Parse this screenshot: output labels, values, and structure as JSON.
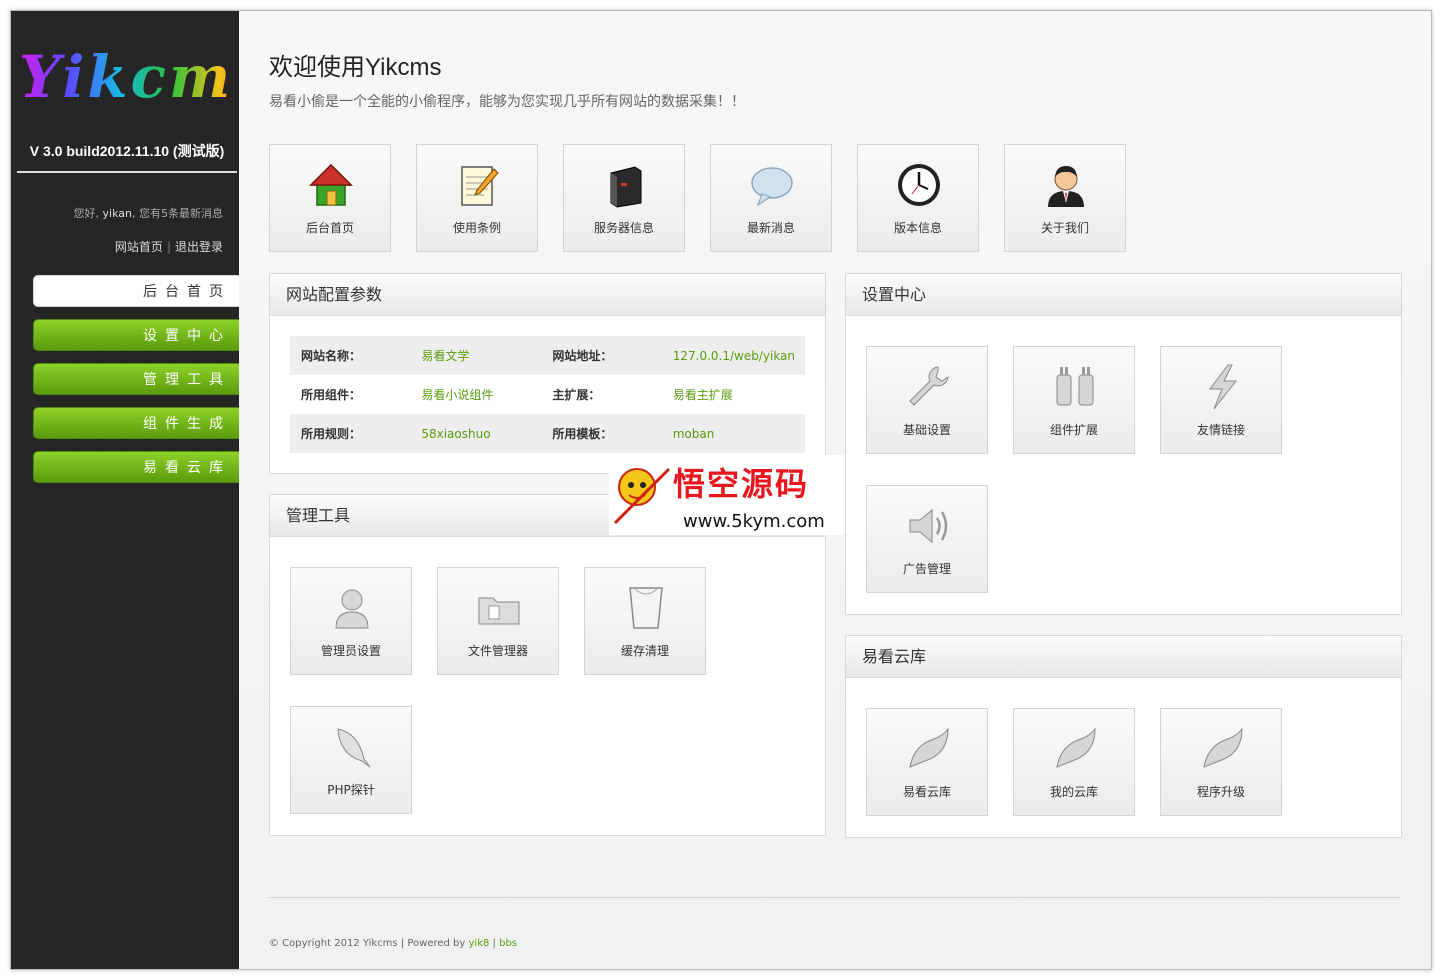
{
  "sidebar": {
    "logo_text": "Yikcms",
    "version": "V 3.0 build2012.11.10 (测试版)",
    "greeting_prefix": "您好,",
    "username": "yikan",
    "greeting_mid": ", 您有",
    "message_count": "5",
    "greeting_suffix": "条最新消息",
    "link_home": "网站首页",
    "link_separator": "|",
    "link_logout": "退出登录",
    "nav": [
      {
        "label": "后台首页",
        "active": true
      },
      {
        "label": "设置中心",
        "active": false
      },
      {
        "label": "管理工具",
        "active": false
      },
      {
        "label": "组件生成",
        "active": false
      },
      {
        "label": "易看云库",
        "active": false
      }
    ]
  },
  "header": {
    "title": "欢迎使用Yikcms",
    "subtitle": "易看小偷是一个全能的小偷程序，能够为您实现几乎所有网站的数据采集！！"
  },
  "quick_tiles": [
    {
      "label": "后台首页",
      "icon": "house-icon"
    },
    {
      "label": "使用条例",
      "icon": "notepad-icon"
    },
    {
      "label": "服务器信息",
      "icon": "server-icon"
    },
    {
      "label": "最新消息",
      "icon": "speech-bubble-icon"
    },
    {
      "label": "版本信息",
      "icon": "clock-icon"
    },
    {
      "label": "关于我们",
      "icon": "user-icon"
    }
  ],
  "config_panel": {
    "title": "网站配置参数",
    "rows": [
      [
        {
          "k": "网站名称：",
          "v": "易看文学"
        },
        {
          "k": "网站地址：",
          "v": "127.0.0.1/web/yikan"
        }
      ],
      [
        {
          "k": "所用组件：",
          "v": "易看小说组件"
        },
        {
          "k": "主扩展：",
          "v": "易看主扩展"
        }
      ],
      [
        {
          "k": "所用规则：",
          "v": "58xiaoshuo"
        },
        {
          "k": "所用模板：",
          "v": "moban"
        }
      ]
    ]
  },
  "tools_panel": {
    "title": "管理工具",
    "tiles": [
      {
        "label": "管理员设置",
        "icon": "admin-user-icon"
      },
      {
        "label": "文件管理器",
        "icon": "folder-icon"
      },
      {
        "label": "缓存清理",
        "icon": "cup-icon"
      },
      {
        "label": "PHP探针",
        "icon": "feather-icon"
      }
    ]
  },
  "settings_panel": {
    "title": "设置中心",
    "tiles": [
      {
        "label": "基础设置",
        "icon": "wrench-icon"
      },
      {
        "label": "组件扩展",
        "icon": "plug-icon"
      },
      {
        "label": "友情链接",
        "icon": "lightning-icon"
      },
      {
        "label": "广告管理",
        "icon": "speaker-icon"
      }
    ]
  },
  "cloud_panel": {
    "title": "易看云库",
    "tiles": [
      {
        "label": "易看云库",
        "icon": "leaf-icon"
      },
      {
        "label": "我的云库",
        "icon": "leaf-icon"
      },
      {
        "label": "程序升级",
        "icon": "leaf-icon"
      }
    ]
  },
  "watermark": {
    "title": "悟空源码",
    "url": "www.5kym.com"
  },
  "footer": {
    "text": "© Copyright 2012 Yikcms | Powered by",
    "link1": "yik8",
    "separator": "|",
    "link2": "bbs"
  },
  "colors": {
    "accent_green": "#5a9b0c",
    "sidebar_bg": "#242424",
    "watermark_red": "#e8171f"
  }
}
